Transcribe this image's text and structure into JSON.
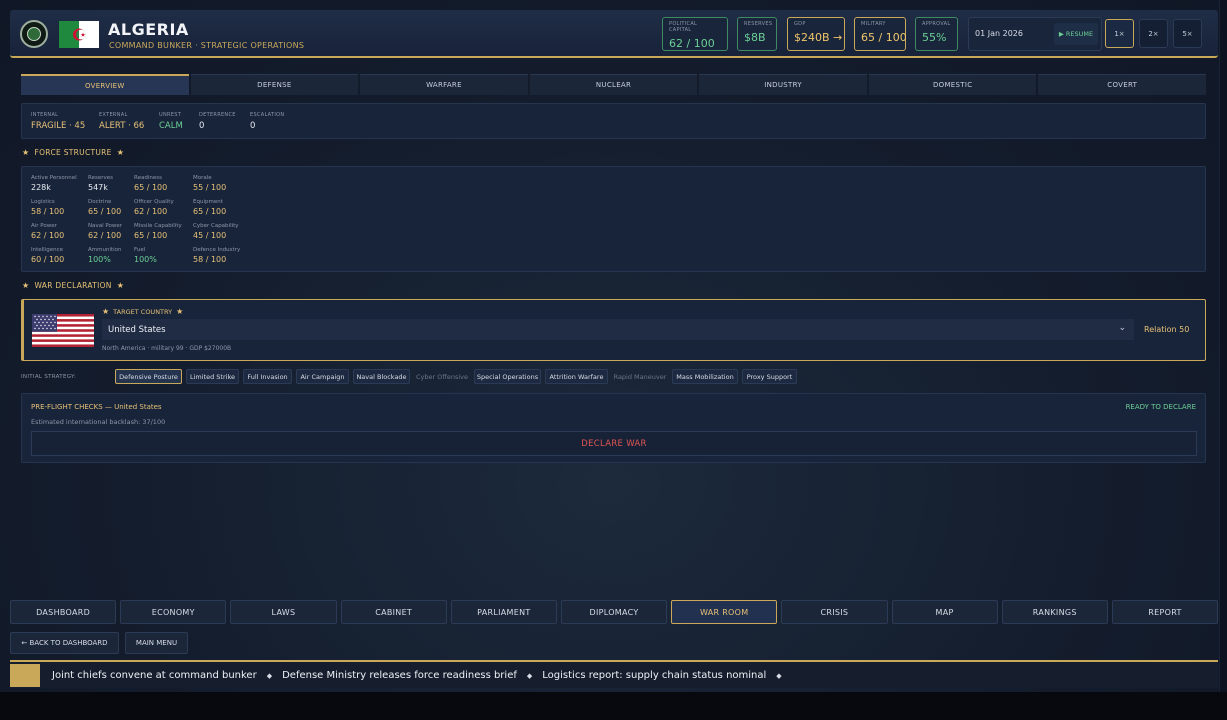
{
  "header": {
    "country": "ALGERIA",
    "subtitle": "COMMAND BUNKER · STRATEGIC OPERATIONS",
    "stats": [
      {
        "label": "POLITICAL CAPITAL",
        "value": "62 / 100"
      },
      {
        "label": "RESERVES",
        "value": "$8B"
      },
      {
        "label": "GDP",
        "value": "$240B"
      },
      {
        "label": "MILITARY",
        "value": "65 / 100"
      },
      {
        "label": "APPROVAL",
        "value": "55%"
      }
    ],
    "gdp_trend_icon": "arrow-right-icon",
    "date": "01 Jan 2026",
    "resume_label": "RESUME",
    "speeds": [
      "1×",
      "2×",
      "5×"
    ],
    "active_speed": "1×"
  },
  "tabs": [
    "OVERVIEW",
    "DEFENSE",
    "WARFARE",
    "NUCLEAR",
    "INDUSTRY",
    "DOMESTIC",
    "COVERT"
  ],
  "active_tab": "OVERVIEW",
  "metrics": [
    {
      "label": "INTERNAL",
      "value": "FRAGILE · 45"
    },
    {
      "label": "EXTERNAL",
      "value": "ALERT · 66"
    },
    {
      "label": "UNREST",
      "value": "CALM"
    },
    {
      "label": "DETERRENCE",
      "value": "0"
    },
    {
      "label": "ESCALATION",
      "value": "0"
    }
  ],
  "force_structure": {
    "title": "FORCE STRUCTURE",
    "cells": [
      {
        "label": "Active Personnel",
        "value": "228k"
      },
      {
        "label": "Reserves",
        "value": "547k"
      },
      {
        "label": "Readiness",
        "value": "65 / 100"
      },
      {
        "label": "Morale",
        "value": "55 / 100"
      },
      {
        "label": "Logistics",
        "value": "58 / 100"
      },
      {
        "label": "Doctrine",
        "value": "65 / 100"
      },
      {
        "label": "Officer Quality",
        "value": "62 / 100"
      },
      {
        "label": "Equipment",
        "value": "65 / 100"
      },
      {
        "label": "Air Power",
        "value": "62 / 100"
      },
      {
        "label": "Naval Power",
        "value": "62 / 100"
      },
      {
        "label": "Missile Capability",
        "value": "65 / 100"
      },
      {
        "label": "Cyber Capability",
        "value": "45 / 100"
      },
      {
        "label": "Intelligence",
        "value": "60 / 100"
      },
      {
        "label": "Ammunition",
        "value": "100%"
      },
      {
        "label": "Fuel",
        "value": "100%"
      },
      {
        "label": "Defence Industry",
        "value": "58 / 100"
      }
    ]
  },
  "war_declaration": {
    "title": "WAR DECLARATION",
    "target_title": "TARGET COUNTRY",
    "target_country": "United States",
    "relation": "Relation 50",
    "target_meta": "North America · military 99 · GDP $27000B"
  },
  "strategy": {
    "label": "INITIAL STRATEGY:",
    "options": [
      {
        "label": "Defensive Posture",
        "state": "active"
      },
      {
        "label": "Limited Strike",
        "state": "normal"
      },
      {
        "label": "Full Invasion",
        "state": "normal"
      },
      {
        "label": "Air Campaign",
        "state": "normal"
      },
      {
        "label": "Naval Blockade",
        "state": "normal"
      },
      {
        "label": "Cyber Offensive",
        "state": "disabled"
      },
      {
        "label": "Special Operations",
        "state": "normal"
      },
      {
        "label": "Attrition Warfare",
        "state": "normal"
      },
      {
        "label": "Rapid Maneuver",
        "state": "disabled"
      },
      {
        "label": "Mass Mobilization",
        "state": "normal"
      },
      {
        "label": "Proxy Support",
        "state": "normal"
      }
    ]
  },
  "preflight": {
    "title": "PRE-FLIGHT CHECKS — United States",
    "status": "READY TO DECLARE",
    "backlash": "Estimated international backlash: 37/100",
    "declare_label": "DECLARE WAR"
  },
  "nav": [
    "DASHBOARD",
    "ECONOMY",
    "LAWS",
    "CABINET",
    "PARLIAMENT",
    "DIPLOMACY",
    "WAR ROOM",
    "CRISIS",
    "MAP",
    "RANKINGS",
    "REPORT"
  ],
  "active_nav": "WAR ROOM",
  "sub_nav": {
    "back": "← BACK TO DASHBOARD",
    "menu": "MAIN MENU"
  },
  "ticker": [
    "Joint chiefs convene at command bunker",
    "Defense Ministry releases force readiness brief",
    "Logistics report: supply chain status nominal"
  ],
  "colors": {
    "accent_gold": "#c9a85a",
    "positive_green": "#6ccf95",
    "danger_red": "#e05555"
  }
}
